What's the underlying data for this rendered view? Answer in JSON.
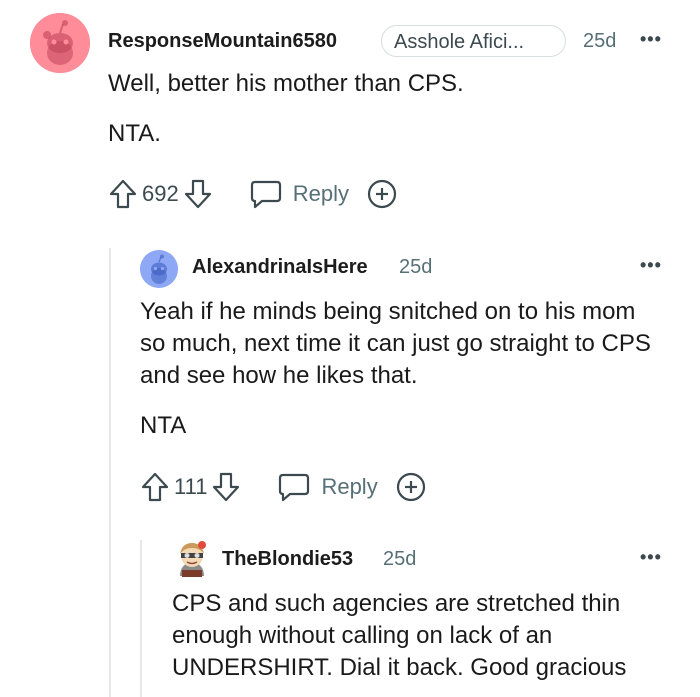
{
  "comments": [
    {
      "username": "ResponseMountain6580",
      "flair": "Asshole Afici...",
      "time": "25d",
      "more": "•••",
      "body": [
        "Well, better his mother than CPS.",
        "NTA."
      ],
      "votes": "692",
      "reply_label": "Reply",
      "avatar_color": "#ff8c99"
    },
    {
      "username": "AlexandrinaIsHere",
      "time": "25d",
      "more": "•••",
      "body": [
        "Yeah if he minds being snitched on to his mom so much, next time it can just go straight to CPS and see how he likes that.",
        "NTA"
      ],
      "votes": "111",
      "reply_label": "Reply",
      "avatar_color": "#8ea8f5"
    },
    {
      "username": "TheBlondie53",
      "time": "25d",
      "more": "•••",
      "body": [
        "CPS and such agencies are stretched thin enough without calling on lack of an UNDERSHIRT. Dial it back. Good gracious"
      ]
    }
  ],
  "icons": {
    "upvote": "upvote-icon",
    "downvote": "downvote-icon",
    "reply": "chat-bubble-icon",
    "award": "award-plus-icon",
    "more": "ellipsis-icon"
  }
}
